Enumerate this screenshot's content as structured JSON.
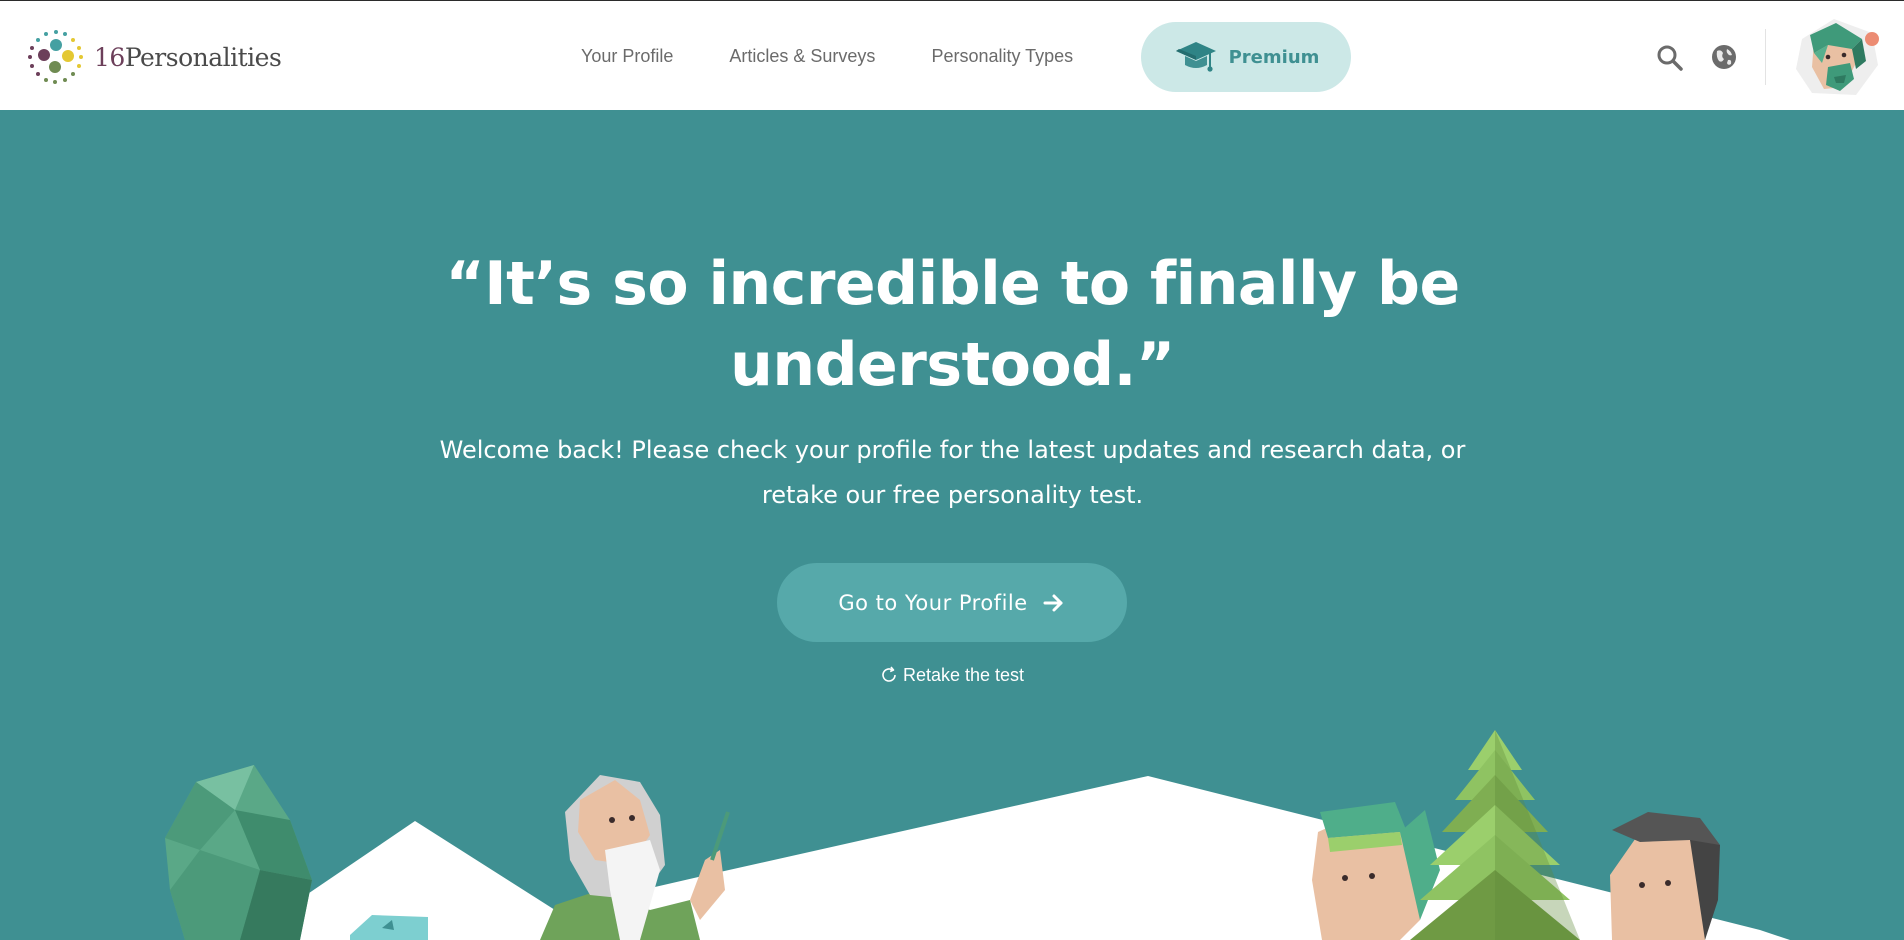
{
  "brand": {
    "number": "16",
    "name": "Personalities"
  },
  "nav": [
    {
      "label": "Your Profile"
    },
    {
      "label": "Articles & Surveys"
    },
    {
      "label": "Personality Types"
    }
  ],
  "premium": {
    "label": "Premium"
  },
  "icons": {
    "search": "search-icon",
    "language": "globe-icon",
    "premium": "graduation-cap-icon",
    "retake": "refresh-icon",
    "cta": "arrow-right-icon"
  },
  "hero": {
    "title": "“It’s so incredible to finally be understood.”",
    "subtitle": "Welcome back! Please check your profile for the latest updates and research data, or retake our free personality test.",
    "cta_label": "Go to Your Profile",
    "retake_label": "Retake the test"
  },
  "colors": {
    "hero_bg": "#3f9092",
    "cta_bg": "#56a9aa",
    "premium_bg": "#cce8e7",
    "premium_text": "#3f9092",
    "notification": "#ec8c73"
  }
}
